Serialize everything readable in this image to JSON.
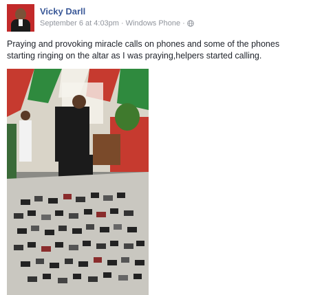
{
  "post": {
    "author": "Vicky Darll",
    "timestamp": "September 6 at 4:03pm",
    "separator": "·",
    "source": "Windows Phone",
    "privacy_icon": "globe-icon",
    "text_line_1": "Praying and provoking miracle calls on phones and some of the phones",
    "text_line_2": "starting ringing on the altar as I was praying,helpers started calling."
  },
  "colors": {
    "author_link": "#3b5998",
    "meta_text": "#90949c",
    "body_text": "#1d2129"
  }
}
